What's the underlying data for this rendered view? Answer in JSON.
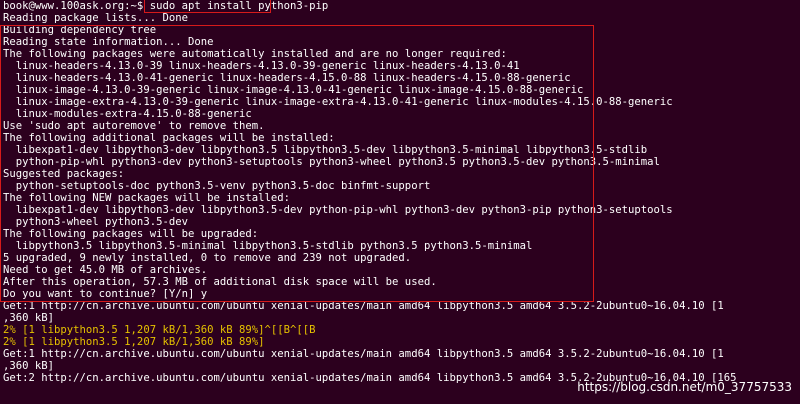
{
  "terminal": {
    "lines": [
      "book@www.100ask.org:~$ sudo apt install python3-pip",
      "Reading package lists... Done",
      "Building dependency tree",
      "Reading state information... Done",
      "The following packages were automatically installed and are no longer required:",
      "  linux-headers-4.13.0-39 linux-headers-4.13.0-39-generic linux-headers-4.13.0-41",
      "  linux-headers-4.13.0-41-generic linux-headers-4.15.0-88 linux-headers-4.15.0-88-generic",
      "  linux-image-4.13.0-39-generic linux-image-4.13.0-41-generic linux-image-4.15.0-88-generic",
      "  linux-image-extra-4.13.0-39-generic linux-image-extra-4.13.0-41-generic linux-modules-4.15.0-88-generic",
      "  linux-modules-extra-4.15.0-88-generic",
      "Use 'sudo apt autoremove' to remove them.",
      "The following additional packages will be installed:",
      "  libexpat1-dev libpython3-dev libpython3.5 libpython3.5-dev libpython3.5-minimal libpython3.5-stdlib",
      "  python-pip-whl python3-dev python3-setuptools python3-wheel python3.5 python3.5-dev python3.5-minimal",
      "Suggested packages:",
      "  python-setuptools-doc python3.5-venv python3.5-doc binfmt-support",
      "The following NEW packages will be installed:",
      "  libexpat1-dev libpython3-dev libpython3.5-dev python-pip-whl python3-dev python3-pip python3-setuptools",
      "  python3-wheel python3.5-dev",
      "The following packages will be upgraded:",
      "  libpython3.5 libpython3.5-minimal libpython3.5-stdlib python3.5 python3.5-minimal",
      "5 upgraded, 9 newly installed, 0 to remove and 239 not upgraded.",
      "Need to get 45.0 MB of archives.",
      "After this operation, 57.3 MB of additional disk space will be used.",
      "Do you want to continue? [Y/n] y",
      "Get:1 http://cn.archive.ubuntu.com/ubuntu xenial-updates/main amd64 libpython3.5 amd64 3.5.2-2ubuntu0~16.04.10 [1",
      ",360 kB]",
      "2% [1 libpython3.5 1,207 kB/1,360 kB 89%]^[[B^[[B",
      "2% [1 libpython3.5 1,207 kB/1,360 kB 89%]",
      "Get:1 http://cn.archive.ubuntu.com/ubuntu xenial-updates/main amd64 libpython3.5 amd64 3.5.2-2ubuntu0~16.04.10 [1",
      ",360 kB]",
      "Get:2 http://cn.archive.ubuntu.com/ubuntu xenial-updates/main amd64 libpython3.5 amd64 3.5.2-2ubuntu0~16.04.10 [165"
    ],
    "text_color": "#ffffff",
    "progress_color": "#e5c100",
    "background": "#2c001e",
    "highlight_color": "#d61a1a"
  },
  "watermark": {
    "text": "https://blog.csdn.net/m0_37757533"
  }
}
